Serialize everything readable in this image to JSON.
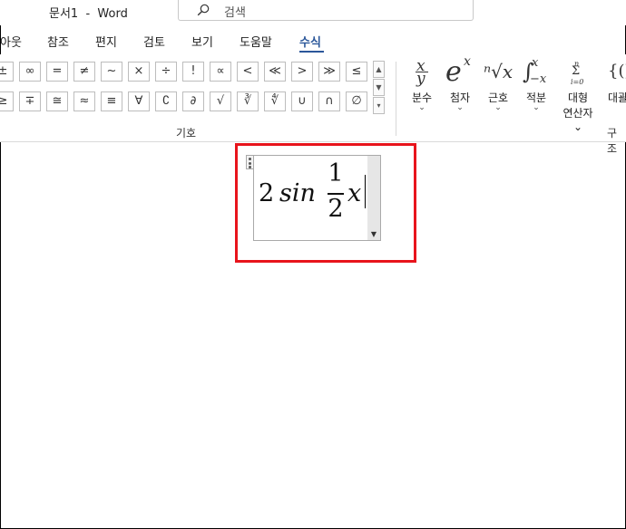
{
  "window": {
    "title": "문서1  -  Word",
    "search_placeholder": "검색"
  },
  "tabs": [
    {
      "label": "아웃"
    },
    {
      "label": "참조"
    },
    {
      "label": "편지"
    },
    {
      "label": "검토"
    },
    {
      "label": "보기"
    },
    {
      "label": "도움말"
    },
    {
      "label": "수식",
      "active": true
    }
  ],
  "symbols": {
    "row1": [
      "±",
      "∞",
      "=",
      "≠",
      "~",
      "×",
      "÷",
      "!",
      "∝",
      "<",
      "≪",
      ">",
      "≫",
      "≤"
    ],
    "row2": [
      "≥",
      "∓",
      "≅",
      "≈",
      "≡",
      "∀",
      "∁",
      "∂",
      "√",
      "∛",
      "∜",
      "∪",
      "∩",
      "∅"
    ],
    "group_label": "기호"
  },
  "structures": {
    "items": [
      {
        "label": "분수",
        "icon": "fraction-icon",
        "glyph_top": "x",
        "glyph_bottom": "y"
      },
      {
        "label": "첨자",
        "icon": "script-icon",
        "glyph_base": "e",
        "glyph_sup": "x"
      },
      {
        "label": "근호",
        "icon": "radical-icon",
        "glyph": "ⁿ√x"
      },
      {
        "label": "적분",
        "icon": "integral-icon",
        "glyph": "∫",
        "glyph_sup": "x",
        "glyph_sub": "−x"
      },
      {
        "label": "대형",
        "label2": "연산자",
        "icon": "large-operator-icon",
        "glyph_top": "n",
        "glyph": "Σ",
        "glyph_bottom": "i=0"
      },
      {
        "label": "대괄",
        "icon": "bracket-icon",
        "glyph": "{()"
      }
    ],
    "group_label": "구조"
  },
  "equation": {
    "coefficient": "2",
    "function": "sin",
    "numerator": "1",
    "denominator": "2",
    "variable": "x"
  },
  "colors": {
    "accent": "#2b579a",
    "highlight": "#e8141c"
  }
}
